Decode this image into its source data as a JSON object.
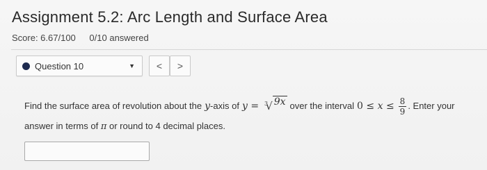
{
  "header": {
    "title": "Assignment 5.2: Arc Length and Surface Area",
    "score": "Score: 6.67/100",
    "answered": "0/10 answered"
  },
  "question_nav": {
    "selected": "Question 10",
    "prev_icon": "chevron-left-icon",
    "next_icon": "chevron-right-icon",
    "prev_glyph": "<",
    "next_glyph": ">",
    "dropdown_glyph": "▼",
    "status_color": "#1d2a4f"
  },
  "question": {
    "text_before": "Find the surface area of revolution about the",
    "axis_var": "y",
    "text_axis": "-axis of",
    "eq_lhs": "y",
    "eq_sign": "=",
    "root_index": "3",
    "root_radicand": "9x",
    "text_interval": "over the interval",
    "lower_bound": "0",
    "leq1": "≤",
    "var": "x",
    "leq2": "≤",
    "frac_num": "8",
    "frac_den": "9",
    "text_after": ". Enter your",
    "line2_before": "answer in terms of",
    "pi": "π",
    "line2_after": "or round to 4 decimal places."
  },
  "answer": {
    "value": "",
    "placeholder": ""
  }
}
